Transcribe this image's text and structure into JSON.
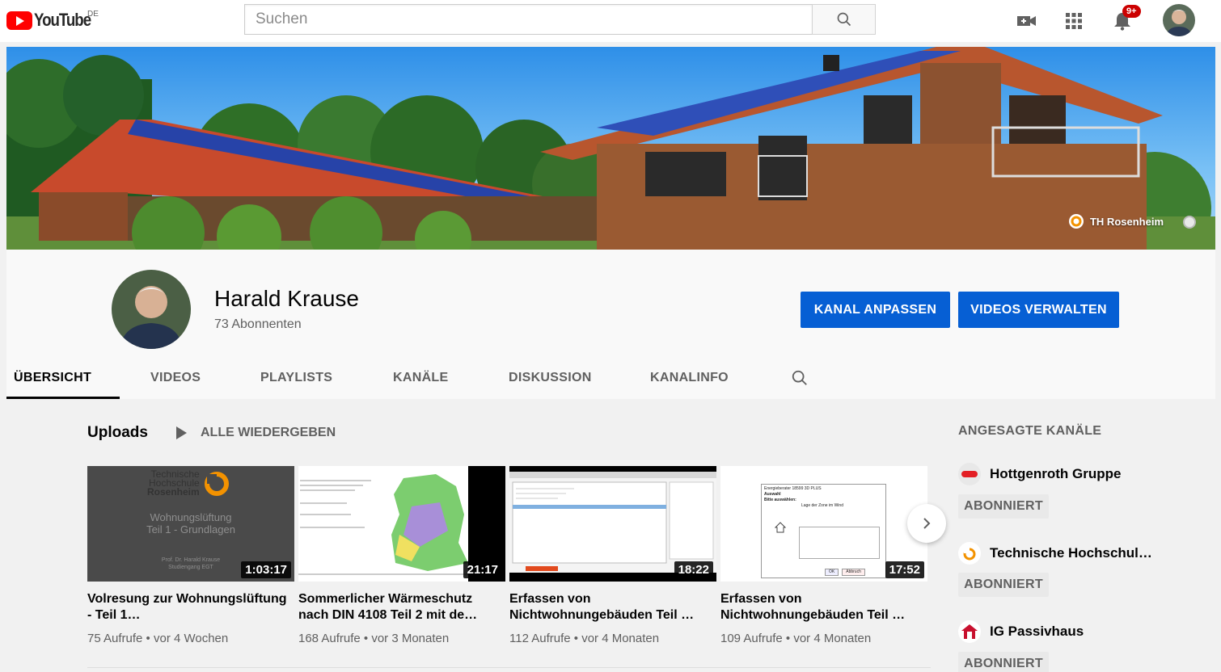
{
  "header": {
    "logo_text": "YouTube",
    "region": "DE",
    "search_placeholder": "Suchen",
    "notification_count": "9+",
    "icons": [
      "video-camera-icon",
      "apps-grid-icon",
      "bell-icon",
      "search-icon"
    ]
  },
  "banner": {
    "link_label": "TH Rosenheim"
  },
  "channel": {
    "name": "Harald Krause",
    "subscribers": "73 Abonnenten",
    "customize_label": "KANAL ANPASSEN",
    "manage_label": "VIDEOS VERWALTEN"
  },
  "tabs": [
    {
      "label": "ÜBERSICHT",
      "active": true
    },
    {
      "label": "VIDEOS"
    },
    {
      "label": "PLAYLISTS"
    },
    {
      "label": "KANÄLE"
    },
    {
      "label": "DISKUSSION"
    },
    {
      "label": "KANALINFO"
    }
  ],
  "uploads": {
    "title": "Uploads",
    "play_all": "ALLE WIEDERGEBEN",
    "videos": [
      {
        "title": "Volresung zur Wohnungslüftung - Teil 1…",
        "duration": "1:03:17",
        "meta": "75 Aufrufe • vor 4 Wochen",
        "thumb": {
          "logo_line1": "Technische",
          "logo_line2": "Hochschule",
          "logo_line3": "Rosenheim",
          "heading1": "Wohnungslüftung",
          "heading2": "Teil 1 - Grundlagen",
          "author": "Prof. Dr. Harald Krause",
          "program": "Studiengang EGT"
        }
      },
      {
        "title": "Sommerlicher Wärmeschutz nach DIN 4108 Teil 2 mit de…",
        "duration": "21:17",
        "meta": "168 Aufrufe • vor 3 Monaten"
      },
      {
        "title": "Erfassen von Nichtwohnungebäuden Teil …",
        "duration": "18:22",
        "meta": "112 Aufrufe • vor 4 Monaten"
      },
      {
        "title": "Erfassen von Nichtwohnungebäuden Teil …",
        "duration": "17:52",
        "meta": "109 Aufrufe • vor 4 Monaten",
        "thumb": {
          "dialog_title": "Energieberater 18599 3D PLUS",
          "dialog_section": "Auswahl",
          "dialog_prompt": "Bitte auswählen:",
          "dialog_field": "Lage der Zone im Wind",
          "ok": "OK",
          "cancel": "Abbruch"
        }
      }
    ]
  },
  "featured": {
    "title": "ANGESAGTE KANÄLE",
    "subscribe_label": "ABONNIERT",
    "channels": [
      {
        "name": "Hottgenroth Gruppe",
        "color": "#e31e24"
      },
      {
        "name": "Technische Hochschul…",
        "color": "#f39200"
      },
      {
        "name": "IG Passivhaus",
        "color": "#c8102e"
      }
    ]
  },
  "colors": {
    "accent_blue": "#065fd4",
    "youtube_red": "#ff0000",
    "badge_red": "#cc0000"
  }
}
